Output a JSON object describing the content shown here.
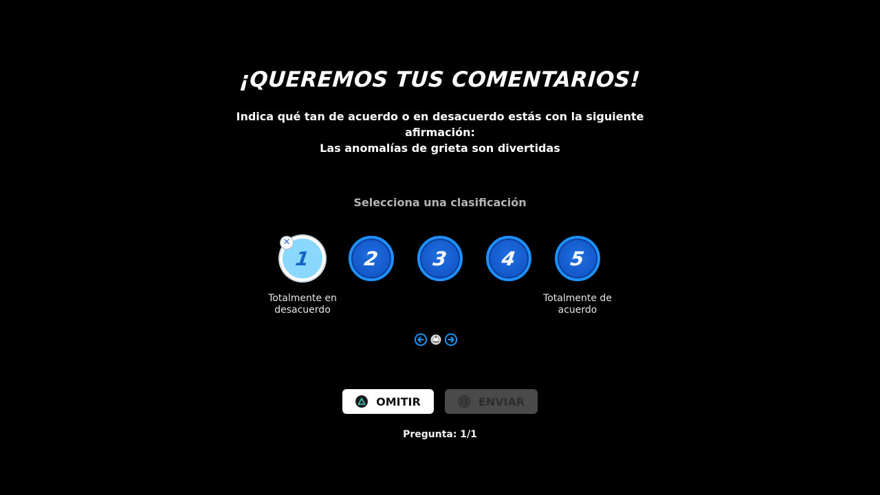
{
  "title": "¡QUEREMOS TUS COMENTARIOS!",
  "prompt": {
    "instruction": "Indica qué tan de acuerdo o en desacuerdo estás con la siguiente afirmación:",
    "statement": "Las anomalías de grieta son divertidas"
  },
  "rating_section": {
    "label": "Selecciona una clasificación",
    "options": [
      "1",
      "2",
      "3",
      "4",
      "5"
    ],
    "selected": "1",
    "low_label": "Totalmente en desacuerdo",
    "high_label": "Totalmente de acuerdo",
    "clear_icon": "close-icon",
    "close_glyph": "✕"
  },
  "navigation_hint": {
    "left_icon": "arrow-left-icon",
    "stick_icon": "left-stick-icon",
    "right_icon": "arrow-right-icon"
  },
  "buttons": {
    "skip_label": "OMITIR",
    "skip_icon": "triangle-button-icon",
    "send_label": "ENVIAR",
    "send_icon": "square-button-icon",
    "send_enabled": false
  },
  "counter": "Pregunta: 1/1",
  "colors": {
    "background": "#000000",
    "rating_blue": "#1457c9",
    "rating_border": "#1e90ff",
    "selected_fill": "#8ad8ff",
    "arrow_blue": "#1e8fe6",
    "disabled_button": "#4a4a4a"
  }
}
